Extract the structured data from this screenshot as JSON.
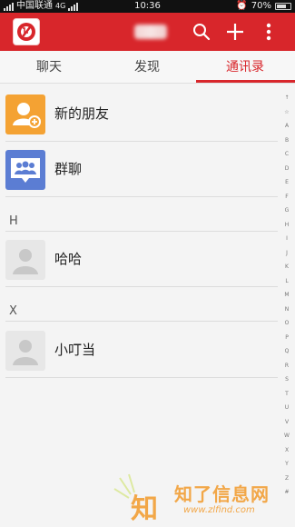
{
  "status_bar": {
    "carrier": "中国联通",
    "network": "4G",
    "time": "10:36",
    "battery": "70%",
    "battery_level": 0.7
  },
  "header": {
    "account_name": "聊聊",
    "icons": [
      "search-icon",
      "plus-icon",
      "more-vertical-icon"
    ],
    "accent_color": "#d8262b"
  },
  "tabs": [
    {
      "label": "聊天",
      "active": false
    },
    {
      "label": "发现",
      "active": false
    },
    {
      "label": "通讯录",
      "active": true
    }
  ],
  "entries": [
    {
      "label": "新的朋友",
      "icon": "new-friend-icon"
    },
    {
      "label": "群聊",
      "icon": "group-chat-icon"
    }
  ],
  "sections": [
    {
      "letter": "H",
      "contacts": [
        {
          "name": "哈哈"
        }
      ]
    },
    {
      "letter": "X",
      "contacts": [
        {
          "name": "小叮当"
        }
      ]
    }
  ],
  "alphabet": [
    "↑",
    "☆",
    "A",
    "B",
    "C",
    "D",
    "E",
    "F",
    "G",
    "H",
    "I",
    "J",
    "K",
    "L",
    "M",
    "N",
    "O",
    "P",
    "Q",
    "R",
    "S",
    "T",
    "U",
    "V",
    "W",
    "X",
    "Y",
    "Z",
    "#"
  ],
  "watermark": {
    "logo_text": "知",
    "text": "知了信息网",
    "url": "www.zlfind.com"
  }
}
